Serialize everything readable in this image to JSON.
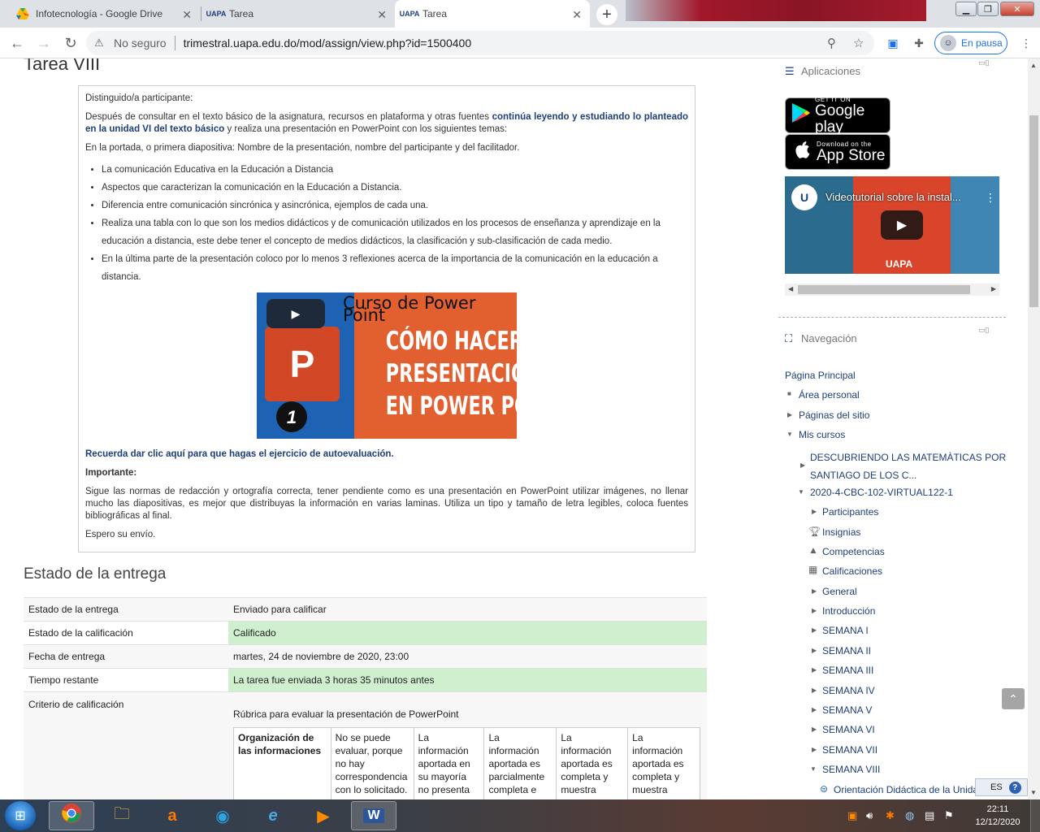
{
  "browser": {
    "tabs": [
      {
        "title": "Infotecnología - Google Drive",
        "icon": "google-drive-icon"
      },
      {
        "title": "Tarea",
        "icon": "uapa-icon"
      },
      {
        "title": "Tarea",
        "icon": "uapa-icon"
      }
    ],
    "active_tab_index": 2,
    "security_label": "No seguro",
    "url": "trimestral.uapa.edu.do/mod/assign/view.php?id=1500400",
    "profile_label": "En pausa"
  },
  "assignment": {
    "title": "Tarea VIII",
    "greeting": "Distinguido/a participante:",
    "intro_pre": "Después de consultar en el texto básico de la asignatura, recursos en plataforma y  otras fuentes ",
    "intro_link1": "continúa leyendo y estudiando lo planteado en  la unidad VI",
    "intro_link2": "del texto básico",
    "intro_post": " y realiza una presentación en PowerPoint con los siguientes temas:",
    "cover_line": "En la portada, o primera diapositiva: Nombre de la presentación, nombre del participante y del facilitador.",
    "topics": [
      "La comunicación Educativa en la Educación a Distancia",
      "Aspectos que caracterizan la comunicación en la Educación a Distancia.",
      "Diferencia entre comunicación sincrónica y asincrónica, ejemplos de cada una.",
      "Realiza una tabla con lo que son los medios didácticos y de comunicación utilizados en los procesos de enseñanza y aprendizaje en la educación a distancia, este debe tener el concepto de medios didácticos, la clasificación y sub-clasificación de cada medio.",
      "En la última parte de la presentación coloco por lo menos 3 reflexiones acerca de la importancia de la comunicación en la educación a distancia."
    ],
    "video": {
      "subtitle": "Curso de Power Point",
      "headline": [
        "CÓMO HACER UNA",
        "PRESENTACIÓN",
        "EN POWER POINT"
      ],
      "number": "1",
      "ppt_letter": "P"
    },
    "selfeval_link": "Recuerda dar clic aquí para que hagas el ejercicio de autoevaluación.",
    "important_label": "Importante:",
    "important_text": "Sigue las normas de redacción y ortografía correcta, tener pendiente como es una presentación en PowerPoint utilizar imágenes, no llenar mucho las diapositivas, es mejor que distribuyas la información en varias laminas.  Utiliza un tipo y tamaño de letra legibles, coloca fuentes bibliográficas al final.",
    "closing": "Espero su envío."
  },
  "submission_status": {
    "title": "Estado de la entrega",
    "rows": [
      {
        "label": "Estado de la entrega",
        "value": "Enviado para calificar"
      },
      {
        "label": "Estado de la calificación",
        "value": "Calificado"
      },
      {
        "label": "Fecha de entrega",
        "value": "martes, 24 de noviembre de 2020, 23:00"
      },
      {
        "label": "Tiempo restante",
        "value": "La tarea fue enviada 3 horas 35 minutos antes"
      }
    ],
    "criteria_label": "Criterio de calificación",
    "rubric_name": "Rúbrica para evaluar la presentación de PowerPoint",
    "rubric_row": [
      "Organización de las informaciones",
      "No se puede evaluar, porque no hay correspondencia con lo solicitado.",
      "La información aportada en su mayoría no presenta",
      "La información aportada es parcialmente completa e",
      "La información aportada es completa y muestra",
      "La información aportada es completa y muestra"
    ],
    "success_color": "#cfefcf"
  },
  "apps_block": {
    "title": "Aplicaciones",
    "google_play_small": "GET IT ON",
    "google_play_large": "Google play",
    "app_store_small": "Download on the",
    "app_store_large": "App Store",
    "video_title": "Videotutorial sobre la instal...",
    "video_brand": "UAPA"
  },
  "nav_block": {
    "title": "Navegación",
    "home": "Página Principal",
    "personal": "Área personal",
    "site_pages": "Páginas del sitio",
    "my_courses": "Mis cursos",
    "course1": [
      "DESCUBRIENDO LAS MATEMÀTICAS POR",
      "SANTIAGO DE LOS C..."
    ],
    "course2": "2020-4-CBC-102-VIRTUAL122-1",
    "course2_items": [
      {
        "label": "Participantes",
        "icon": "chevron-right-icon"
      },
      {
        "label": "Insignias",
        "icon": "trophy-icon"
      },
      {
        "label": "Competencias",
        "icon": "competencies-icon"
      },
      {
        "label": "Calificaciones",
        "icon": "table-icon"
      },
      {
        "label": "General",
        "icon": "chevron-right-icon"
      },
      {
        "label": "Introducción",
        "icon": "chevron-right-icon"
      },
      {
        "label": "SEMANA I",
        "icon": "chevron-right-icon"
      },
      {
        "label": "SEMANA II",
        "icon": "chevron-right-icon"
      },
      {
        "label": "SEMANA III",
        "icon": "chevron-right-icon"
      },
      {
        "label": "SEMANA IV",
        "icon": "chevron-right-icon"
      },
      {
        "label": "SEMANA V",
        "icon": "chevron-right-icon"
      },
      {
        "label": "SEMANA VI",
        "icon": "chevron-right-icon"
      },
      {
        "label": "SEMANA VII",
        "icon": "chevron-right-icon"
      },
      {
        "label": "SEMANA VIII",
        "icon": "chevron-down-icon"
      }
    ],
    "week8_item": "Orientación Didáctica de la Unida"
  },
  "os": {
    "language": "ES",
    "time": "22:11",
    "date": "12/12/2020"
  }
}
